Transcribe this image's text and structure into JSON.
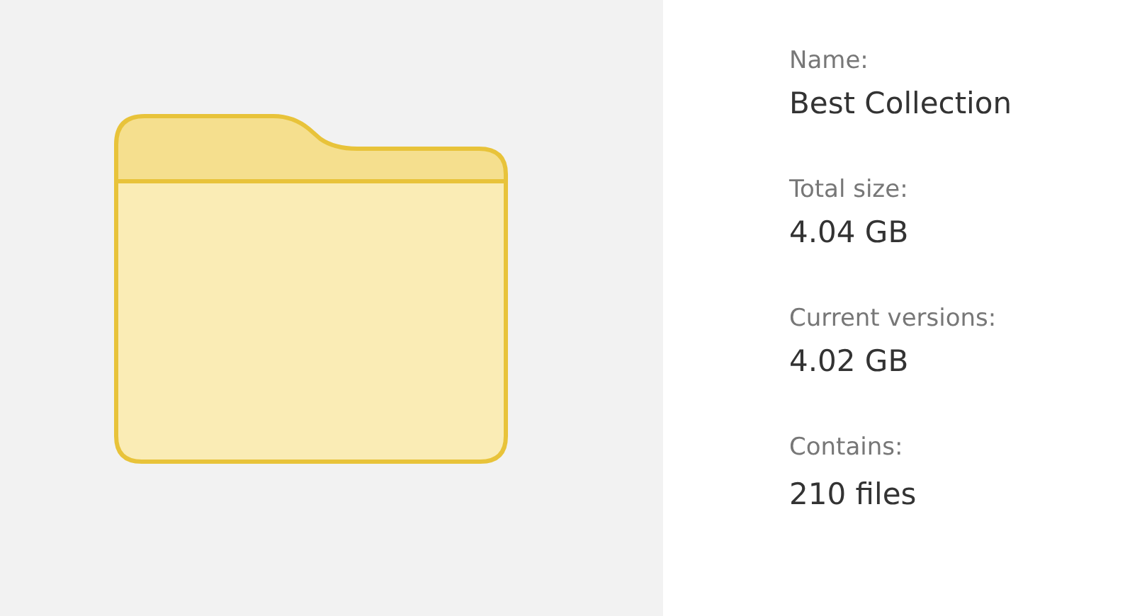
{
  "preview": {
    "kind": "folder"
  },
  "details": [
    {
      "label": "Name:",
      "value": "Best Collection"
    },
    {
      "label": "Total size:",
      "value": "4.04 GB"
    },
    {
      "label": "Current versions:",
      "value": "4.02 GB"
    },
    {
      "label": "Contains:",
      "value": "210 files"
    }
  ]
}
